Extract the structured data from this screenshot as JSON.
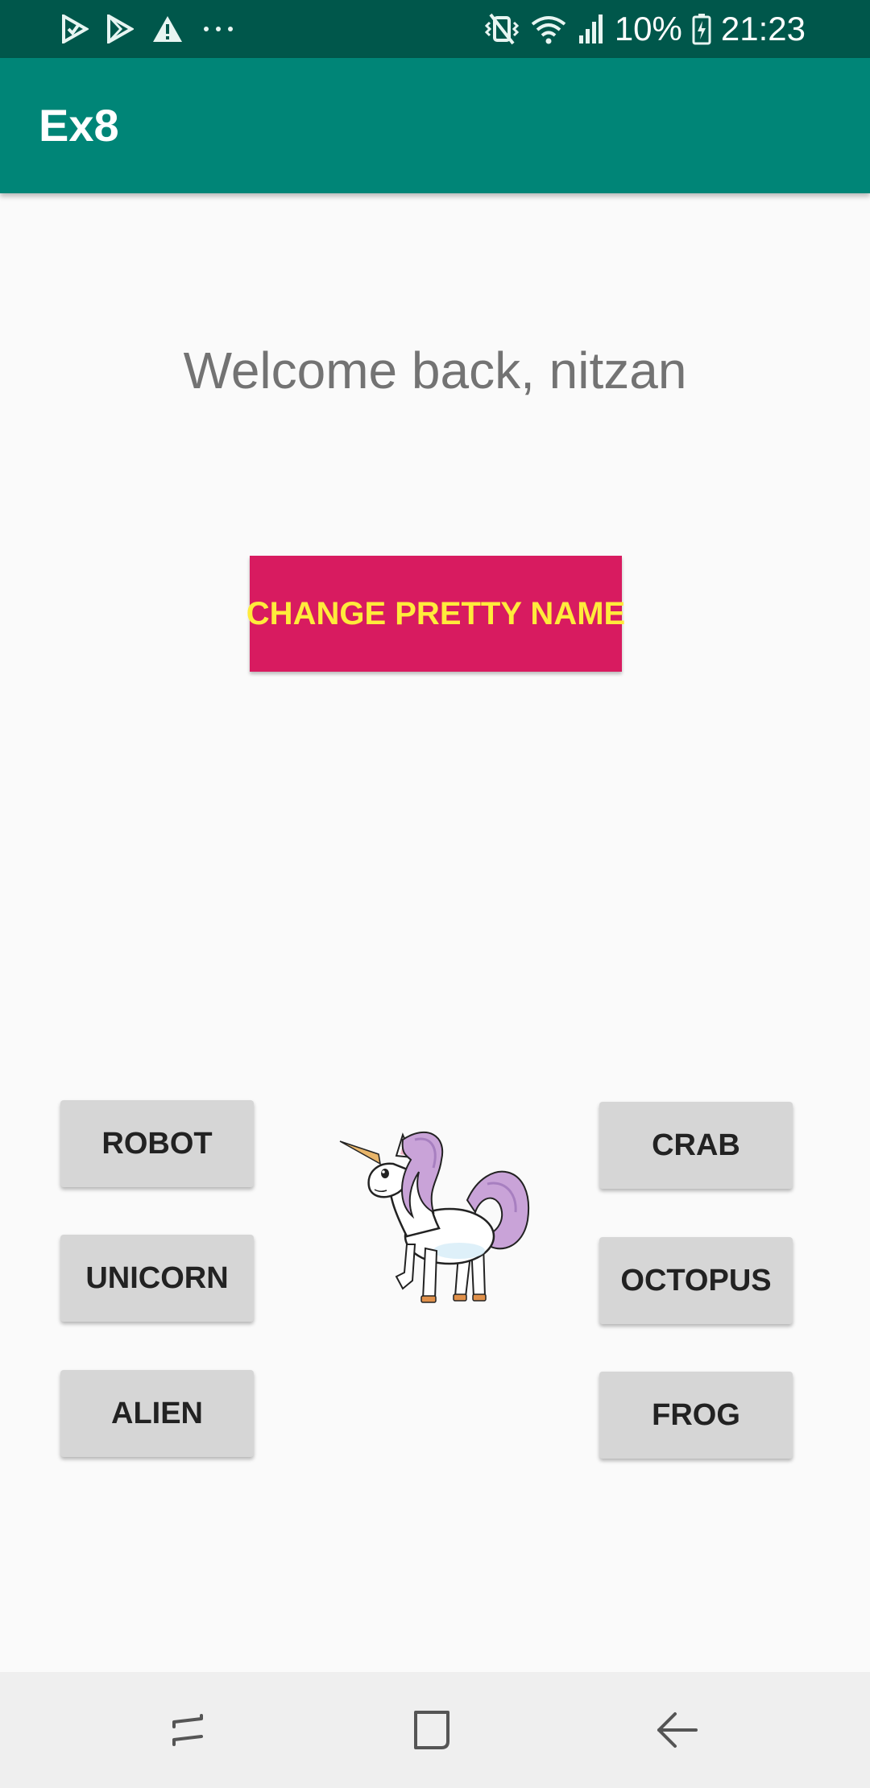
{
  "status_bar": {
    "battery_text": "10%",
    "time": "21:23",
    "icons": [
      "play-store-check-icon",
      "play-store-icon",
      "warning-icon",
      "more-notifications-icon",
      "vibrate-icon",
      "wifi-icon",
      "signal-icon",
      "battery-icon"
    ]
  },
  "app_bar": {
    "title": "Ex8"
  },
  "main": {
    "welcome_text": "Welcome back, nitzan",
    "change_name_button": "CHANGE PRETTY NAME",
    "choices_left": [
      "ROBOT",
      "UNICORN",
      "ALIEN"
    ],
    "choices_right": [
      "CRAB",
      "OCTOPUS",
      "FROG"
    ],
    "selected_pet_image": "unicorn-image"
  },
  "nav_bar": {
    "icons": [
      "recents-icon",
      "home-icon",
      "back-icon"
    ]
  },
  "colors": {
    "status_bar": "#00574b",
    "app_bar": "#008577",
    "accent_button": "#d81b60",
    "accent_button_text": "#ffeb3b",
    "choice_button": "#d6d6d6"
  }
}
